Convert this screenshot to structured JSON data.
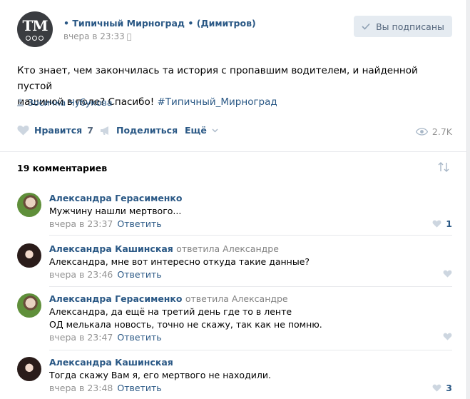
{
  "post": {
    "group_name": "• Типичный Мирноград • (Димитров)",
    "avatar_text": "TM",
    "time": "вчера в 23:33",
    "subscribe_label": "Вы подписаны",
    "text_line1": "Кто знает, чем закончилась та история с пропавшим водителем, и найденной пустой",
    "text_line2": "машиной в поле? Спасибо! ",
    "hashtag": "#Типичный_Мирноград",
    "author": "Зосичка Чубукова"
  },
  "actions": {
    "like_label": "Нравится",
    "like_count": "7",
    "share_label": "Поделиться",
    "more_label": "Ещё",
    "views": "2.7K"
  },
  "comments_header": "19 комментариев",
  "comments": [
    {
      "name": "Александра Герасименко",
      "reply_to": "",
      "text_lines": [
        "Мужчину нашли мертвого..."
      ],
      "time": "вчера в 23:37",
      "reply_label": "Ответить",
      "likes": "1"
    },
    {
      "name": "Александра Кашинская",
      "reply_to": "ответила Александре",
      "text_lines": [
        "Александра, мне вот интересно откуда такие данные?"
      ],
      "time": "вчера в 23:46",
      "reply_label": "Ответить",
      "likes": ""
    },
    {
      "name": "Александра Герасименко",
      "reply_to": "ответила Александре",
      "text_lines": [
        "Александра, да ещё на третий день где то в ленте",
        "ОД мелькала новость, точно не скажу, так как не помню."
      ],
      "time": "вчера в 23:47",
      "reply_label": "Ответить",
      "likes": ""
    },
    {
      "name": "Александра Кашинская",
      "reply_to": "",
      "text_lines": [
        "Тогда скажу Вам я, его мертвого не находили."
      ],
      "time": "вчера в 23:48",
      "reply_label": "Ответить",
      "likes": "3"
    }
  ],
  "colors": {
    "link": "#2a5885",
    "muted": "#939393",
    "button_bg": "#e5ebf1",
    "like_icon": "#cdd6e0"
  }
}
